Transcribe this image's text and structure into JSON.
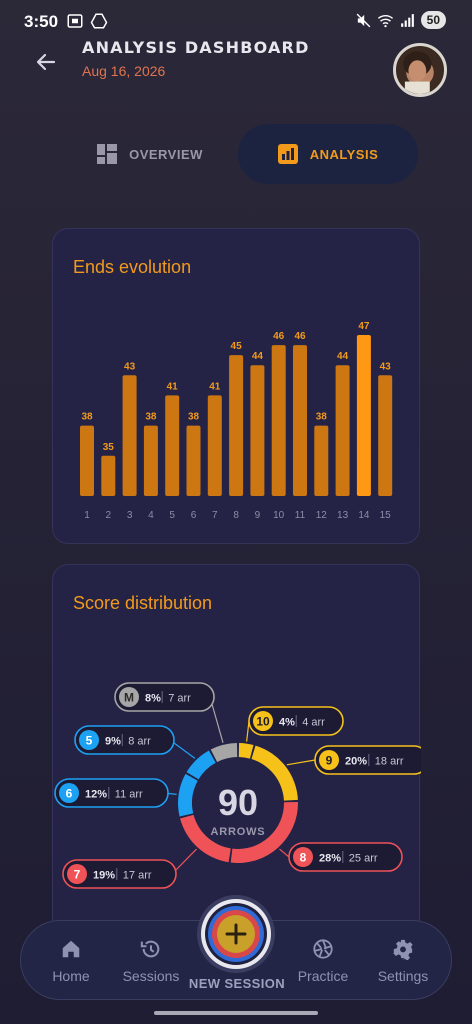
{
  "status_bar": {
    "time": "3:50",
    "battery": "50",
    "left_icons": [
      "screenshot-icon",
      "drive-icon"
    ],
    "right_icons": [
      "mute-icon",
      "wifi-icon",
      "signal-icon"
    ]
  },
  "header": {
    "title": "ANALYSIS DASHBOARD",
    "date": "Aug 16, 2026"
  },
  "tabs": [
    {
      "label": "OVERVIEW",
      "icon": "grid-icon",
      "active": false
    },
    {
      "label": "ANALYSIS",
      "icon": "bar-chart-icon",
      "active": true
    }
  ],
  "colors": {
    "accent": "#f39a1b",
    "bar": "#cc7712",
    "bar_highlight": "#ff9812",
    "gold": "#f6c21a",
    "red": "#ef5358",
    "blue": "#1da1f2",
    "gray": "#a6a6a6"
  },
  "ends_card": {
    "title": "Ends evolution"
  },
  "score_card": {
    "title": "Score distribution",
    "total": "90",
    "total_label": "ARROWS"
  },
  "chart_data": [
    {
      "type": "bar",
      "title": "Ends evolution",
      "categories": [
        "1",
        "2",
        "3",
        "4",
        "5",
        "6",
        "7",
        "8",
        "9",
        "10",
        "11",
        "12",
        "13",
        "14",
        "15"
      ],
      "values": [
        38,
        35,
        43,
        38,
        41,
        38,
        41,
        45,
        44,
        46,
        46,
        38,
        44,
        47,
        43
      ],
      "highlight_index": 13,
      "ylim": [
        31,
        47
      ],
      "grid": false,
      "xlabel": "",
      "ylabel": ""
    },
    {
      "type": "pie",
      "title": "Score distribution",
      "total": 90,
      "segments": [
        {
          "label": "10",
          "percent": "4%",
          "arrows": "4 arr",
          "count": 4,
          "color": "#f6c21a",
          "text_color": "#1d1b2e"
        },
        {
          "label": "9",
          "percent": "20%",
          "arrows": "18 arr",
          "count": 18,
          "color": "#f6c21a",
          "text_color": "#1d1b2e"
        },
        {
          "label": "8",
          "percent": "28%",
          "arrows": "25 arr",
          "count": 25,
          "color": "#ef5358",
          "text_color": "#ffffff"
        },
        {
          "label": "7",
          "percent": "19%",
          "arrows": "17 arr",
          "count": 17,
          "color": "#ef5358",
          "text_color": "#ffffff"
        },
        {
          "label": "6",
          "percent": "12%",
          "arrows": "11 arr",
          "count": 11,
          "color": "#1da1f2",
          "text_color": "#ffffff"
        },
        {
          "label": "5",
          "percent": "9%",
          "arrows": "8 arr",
          "count": 8,
          "color": "#1da1f2",
          "text_color": "#ffffff"
        },
        {
          "label": "M",
          "percent": "8%",
          "arrows": "7 arr",
          "count": 7,
          "color": "#a6a6a6",
          "text_color": "#2a2a2a"
        }
      ]
    }
  ],
  "bottom_nav": {
    "home": "Home",
    "sessions": "Sessions",
    "new_session": "NEW SESSION",
    "practice": "Practice",
    "settings": "Settings"
  }
}
